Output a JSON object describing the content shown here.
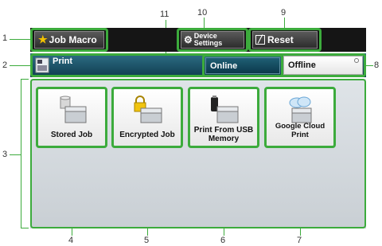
{
  "top_bar": {
    "job_macro_label": "Job Macro",
    "device_settings_label_line1": "Device",
    "device_settings_label_line2": "Settings",
    "reset_label": "Reset"
  },
  "title_bar": {
    "title": "Print",
    "online_label": "Online",
    "offline_label": "Offline"
  },
  "tiles": [
    {
      "label": "Stored Job",
      "icon": "stored-job-icon"
    },
    {
      "label": "Encrypted Job",
      "icon": "encrypted-job-icon"
    },
    {
      "label_line1": "Print From USB",
      "label_line2": "Memory",
      "icon": "usb-memory-icon"
    },
    {
      "label": "Google Cloud Print",
      "icon": "cloud-print-icon"
    }
  ],
  "callouts": {
    "n1": "1",
    "n2": "2",
    "n3": "3",
    "n4": "4",
    "n5": "5",
    "n6": "6",
    "n7": "7",
    "n8": "8",
    "n9": "9",
    "n10": "10",
    "n11": "11"
  },
  "colors": {
    "highlight": "#3cab3c",
    "title_bar": "#1d5368",
    "top_bar": "#151515"
  }
}
